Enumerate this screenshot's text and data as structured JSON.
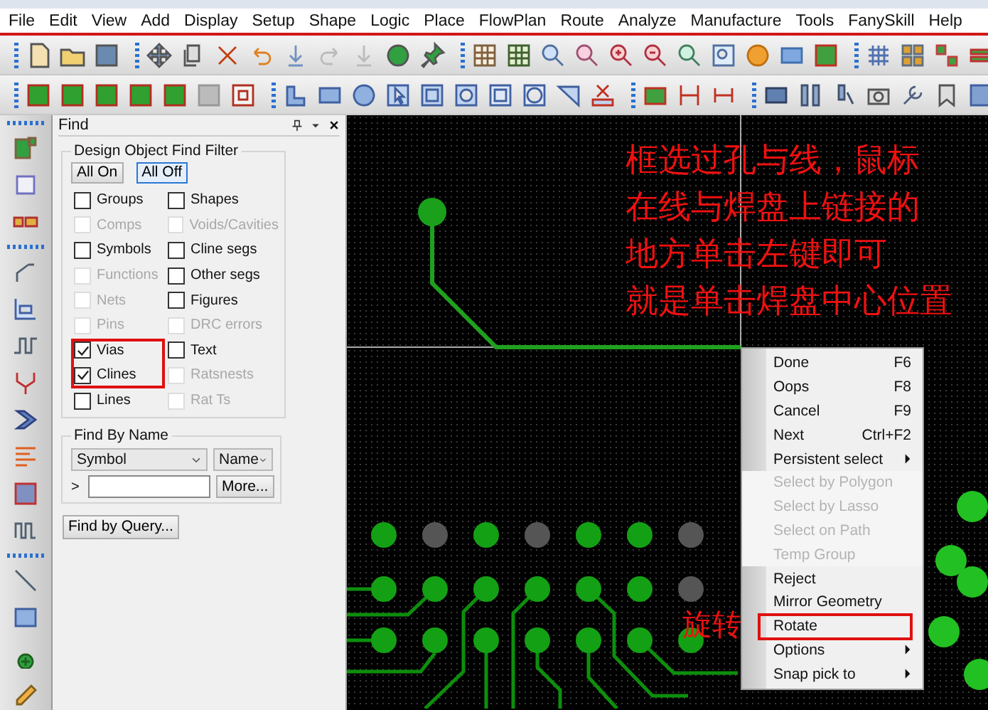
{
  "menu_bar": [
    "File",
    "Edit",
    "View",
    "Add",
    "Display",
    "Setup",
    "Shape",
    "Logic",
    "Place",
    "FlowPlan",
    "Route",
    "Analyze",
    "Manufacture",
    "Tools",
    "FanySkill",
    "Help"
  ],
  "find_panel": {
    "title": "Find",
    "filter_title": "Design Object Find Filter",
    "buttons": [
      {
        "label": "All On",
        "selected": false
      },
      {
        "label": "All Off",
        "selected": true
      }
    ],
    "filters": [
      {
        "label": "Groups",
        "checked": false,
        "disabled": false,
        "highlighted": false
      },
      {
        "label": "Shapes",
        "checked": false,
        "disabled": false,
        "highlighted": false
      },
      {
        "label": "Comps",
        "checked": false,
        "disabled": true,
        "highlighted": false
      },
      {
        "label": "Voids/Cavities",
        "checked": false,
        "disabled": true,
        "highlighted": false
      },
      {
        "label": "Symbols",
        "checked": false,
        "disabled": false,
        "highlighted": false
      },
      {
        "label": "Cline segs",
        "checked": false,
        "disabled": false,
        "highlighted": false
      },
      {
        "label": "Functions",
        "checked": false,
        "disabled": true,
        "highlighted": false
      },
      {
        "label": "Other segs",
        "checked": false,
        "disabled": false,
        "highlighted": false
      },
      {
        "label": "Nets",
        "checked": false,
        "disabled": true,
        "highlighted": false
      },
      {
        "label": "Figures",
        "checked": false,
        "disabled": false,
        "highlighted": false
      },
      {
        "label": "Pins",
        "checked": false,
        "disabled": true,
        "highlighted": false
      },
      {
        "label": "DRC errors",
        "checked": false,
        "disabled": true,
        "highlighted": false
      },
      {
        "label": "Vias",
        "checked": true,
        "disabled": false,
        "highlighted": true
      },
      {
        "label": "Text",
        "checked": false,
        "disabled": false,
        "highlighted": false
      },
      {
        "label": "Clines",
        "checked": true,
        "disabled": false,
        "highlighted": true
      },
      {
        "label": "Ratsnests",
        "checked": false,
        "disabled": true,
        "highlighted": false
      },
      {
        "label": "Lines",
        "checked": false,
        "disabled": false,
        "highlighted": false
      },
      {
        "label": "Rat Ts",
        "checked": false,
        "disabled": true,
        "highlighted": false
      }
    ],
    "find_by_name": {
      "title": "Find By Name",
      "type_select": "Symbol",
      "mode_select": "Name",
      "prompt": ">",
      "more_button": "More..."
    },
    "query_button": "Find by Query..."
  },
  "context_menu": [
    {
      "label": "Done",
      "shortcut": "F6",
      "submenu": false,
      "disabled": false,
      "highlighted": false
    },
    {
      "label": "Oops",
      "shortcut": "F8",
      "submenu": false,
      "disabled": false,
      "highlighted": false
    },
    {
      "label": "Cancel",
      "shortcut": "F9",
      "submenu": false,
      "disabled": false,
      "highlighted": false
    },
    {
      "label": "Next",
      "shortcut": "Ctrl+F2",
      "submenu": false,
      "disabled": false,
      "highlighted": false
    },
    {
      "label": "Persistent select",
      "submenu": true,
      "disabled": false,
      "highlighted": false
    },
    {
      "label": "Select by Polygon",
      "submenu": false,
      "disabled": true,
      "highlighted": false
    },
    {
      "label": "Select by Lasso",
      "submenu": false,
      "disabled": true,
      "highlighted": false
    },
    {
      "label": "Select on Path",
      "submenu": false,
      "disabled": true,
      "highlighted": false
    },
    {
      "label": "Temp Group",
      "submenu": false,
      "disabled": true,
      "highlighted": false
    },
    {
      "label": "Reject",
      "submenu": false,
      "disabled": false,
      "highlighted": false
    },
    {
      "label": "Mirror Geometry",
      "submenu": false,
      "disabled": false,
      "highlighted": false
    },
    {
      "label": "Rotate",
      "submenu": false,
      "disabled": false,
      "highlighted": true
    },
    {
      "label": "Options",
      "submenu": true,
      "disabled": false,
      "highlighted": false
    },
    {
      "label": "Snap pick to",
      "submenu": true,
      "disabled": false,
      "highlighted": false
    }
  ],
  "annotations": {
    "note_lines": [
      "框选过孔与线，鼠标",
      "在线与焊盘上链接的",
      "地方单击左键即可",
      "就是单击焊盘中心位置"
    ],
    "rotate_label": "旋转"
  }
}
